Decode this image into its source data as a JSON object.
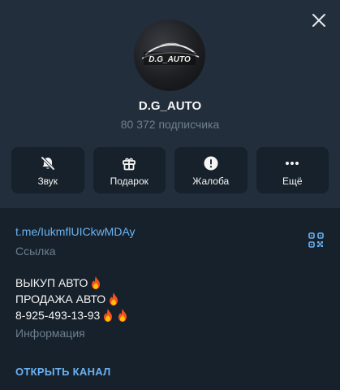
{
  "channel": {
    "title": "D.G_AUTO",
    "subscribers": "80 372 подписчика",
    "avatar_text": "D.G_AUTO"
  },
  "actions": [
    {
      "label": "Звук",
      "icon": "bell-muted-icon"
    },
    {
      "label": "Подарок",
      "icon": "gift-icon"
    },
    {
      "label": "Жалоба",
      "icon": "report-icon"
    },
    {
      "label": "Ещё",
      "icon": "more-dots-icon"
    }
  ],
  "link": {
    "url": "t.me/IukmflUICkwMDAy",
    "caption": "Ссылка"
  },
  "bio": {
    "line1": "ВЫКУП АВТО",
    "line2": "ПРОДАЖА АВТО",
    "line3": "8-925-493-13-93",
    "caption": "Информация"
  },
  "open_channel_label": "ОТКРЫТЬ КАНАЛ",
  "colors": {
    "background": "#17212b",
    "header": "#232e3c",
    "accent": "#6ab3f3",
    "muted": "#6d7f8f"
  }
}
